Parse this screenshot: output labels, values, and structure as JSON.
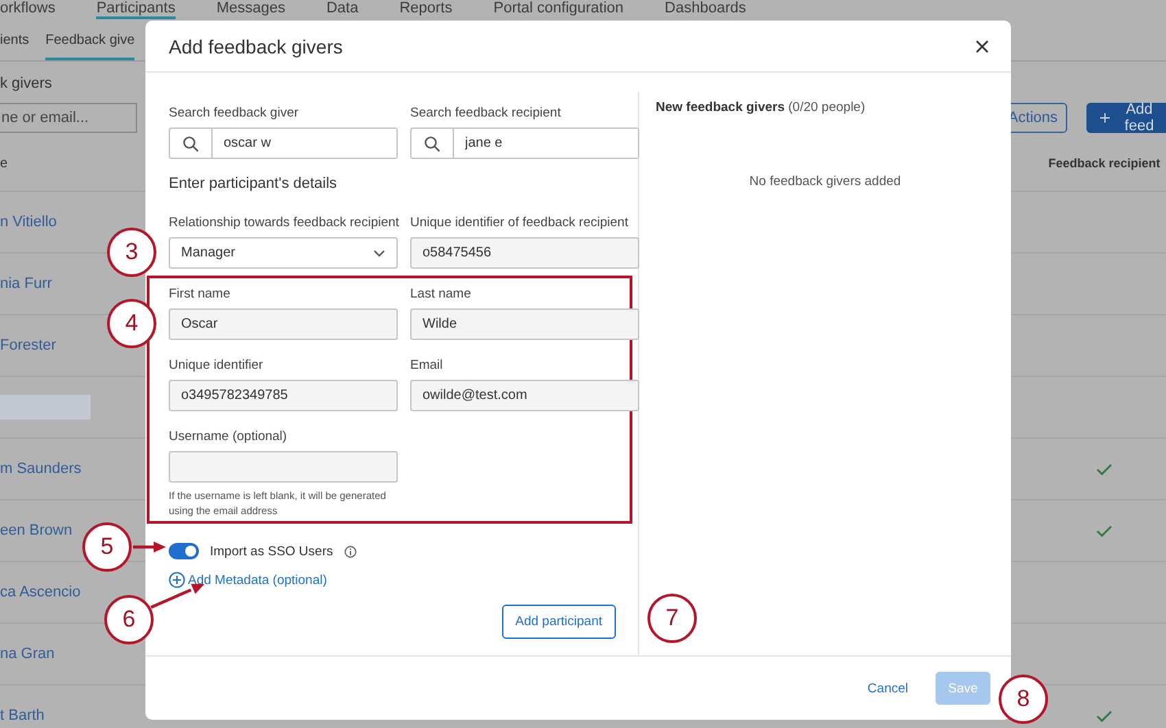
{
  "background": {
    "nav_tabs": [
      {
        "label": "orkflows",
        "selected": false
      },
      {
        "label": "Participants",
        "selected": true
      },
      {
        "label": "Messages",
        "selected": false
      },
      {
        "label": "Data",
        "selected": false
      },
      {
        "label": "Reports",
        "selected": false
      },
      {
        "label": "Portal configuration",
        "selected": false
      },
      {
        "label": "Dashboards",
        "selected": false
      }
    ],
    "sub_tabs": [
      {
        "label": "ients",
        "selected": false
      },
      {
        "label": "Feedback give",
        "selected": true
      }
    ],
    "heading": "k givers",
    "search": {
      "placeholder": "ne or email..."
    },
    "buttons": [
      {
        "label": "Actions",
        "kind": "outline"
      },
      {
        "label": "Add feed",
        "kind": "primary"
      }
    ],
    "table": {
      "columns": [
        "e",
        "Feedback recipient"
      ],
      "rows": [
        {
          "kind": "person",
          "name": "n Vitiello",
          "feedback_recipient": false
        },
        {
          "kind": "person",
          "name": "nia Furr",
          "feedback_recipient": false
        },
        {
          "kind": "person",
          "name": "Forester",
          "feedback_recipient": false
        },
        {
          "kind": "loading"
        },
        {
          "kind": "person",
          "name": "m Saunders",
          "feedback_recipient": true
        },
        {
          "kind": "person",
          "name": "een Brown",
          "feedback_recipient": true
        },
        {
          "kind": "person",
          "name": "ca Ascencio",
          "feedback_recipient": false
        },
        {
          "kind": "person",
          "name": "na Gran",
          "feedback_recipient": false
        },
        {
          "kind": "person",
          "name": "t Barth",
          "feedback_recipient": true
        }
      ]
    }
  },
  "dialog": {
    "title": "Add feedback givers",
    "search_fields": [
      {
        "label": "Search feedback giver",
        "value": "oscar w"
      },
      {
        "label": "Search feedback recipient",
        "value": "jane e"
      }
    ],
    "section_title": "Enter participant's details",
    "relationship": {
      "label": "Relationship towards feedback recipient",
      "value": "Manager"
    },
    "recipient_id": {
      "label": "Unique identifier of feedback recipient",
      "value": "o58475456"
    },
    "details_fields": [
      {
        "label": "First name",
        "value": "Oscar"
      },
      {
        "label": "Last name",
        "value": "Wilde"
      },
      {
        "label": "Unique identifier",
        "value": "o3495782349785"
      },
      {
        "label": "Email",
        "value": "owilde@test.com"
      },
      {
        "label": "Username (optional)",
        "hint": "If the username is left blank, it will be generated using the email address"
      }
    ],
    "sso_toggle": {
      "label": "Import as SSO Users",
      "on": true
    },
    "metadata_link": "Add Metadata (optional)",
    "add_button": "Add participant",
    "panel": {
      "title": "New feedback givers",
      "count": "(0/20 people)",
      "empty_text": "No feedback givers added"
    },
    "cancel": "Cancel",
    "save": {
      "label": "Save",
      "disabled": true
    }
  },
  "annotations": [
    {
      "number": "3"
    },
    {
      "number": "4"
    },
    {
      "number": "5"
    },
    {
      "number": "6"
    },
    {
      "number": "7"
    },
    {
      "number": "8"
    }
  ]
}
